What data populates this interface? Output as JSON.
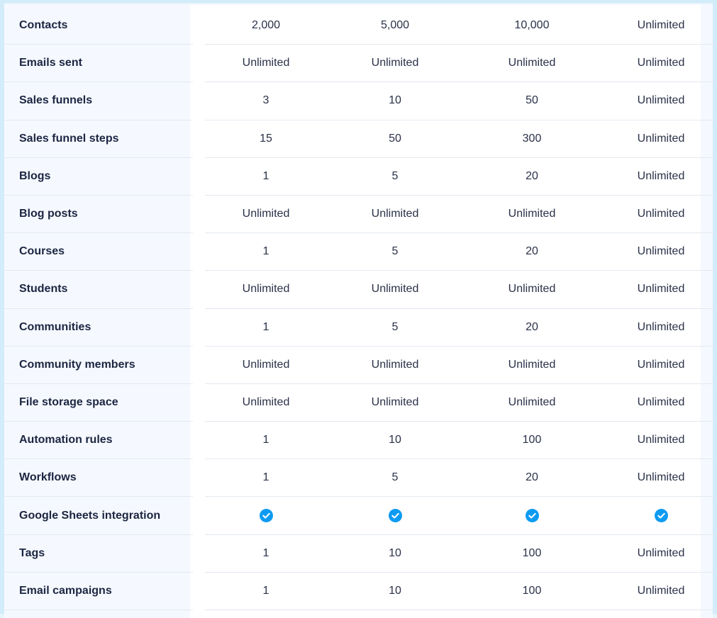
{
  "colors": {
    "accent": "#0d9bf2",
    "text": "#1c2541",
    "row_divider": "#e3e9f1",
    "label_column_bg": "#f5f9ff"
  },
  "rows": [
    {
      "feature": "Contacts",
      "values": [
        "2,000",
        "5,000",
        "10,000",
        "Unlimited"
      ]
    },
    {
      "feature": "Emails sent",
      "values": [
        "Unlimited",
        "Unlimited",
        "Unlimited",
        "Unlimited"
      ]
    },
    {
      "feature": "Sales funnels",
      "values": [
        "3",
        "10",
        "50",
        "Unlimited"
      ]
    },
    {
      "feature": "Sales funnel steps",
      "values": [
        "15",
        "50",
        "300",
        "Unlimited"
      ]
    },
    {
      "feature": "Blogs",
      "values": [
        "1",
        "5",
        "20",
        "Unlimited"
      ]
    },
    {
      "feature": "Blog posts",
      "values": [
        "Unlimited",
        "Unlimited",
        "Unlimited",
        "Unlimited"
      ]
    },
    {
      "feature": "Courses",
      "values": [
        "1",
        "5",
        "20",
        "Unlimited"
      ]
    },
    {
      "feature": "Students",
      "values": [
        "Unlimited",
        "Unlimited",
        "Unlimited",
        "Unlimited"
      ]
    },
    {
      "feature": "Communities",
      "values": [
        "1",
        "5",
        "20",
        "Unlimited"
      ]
    },
    {
      "feature": "Community members",
      "values": [
        "Unlimited",
        "Unlimited",
        "Unlimited",
        "Unlimited"
      ]
    },
    {
      "feature": "File storage space",
      "values": [
        "Unlimited",
        "Unlimited",
        "Unlimited",
        "Unlimited"
      ]
    },
    {
      "feature": "Automation rules",
      "values": [
        "1",
        "10",
        "100",
        "Unlimited"
      ]
    },
    {
      "feature": "Workflows",
      "values": [
        "1",
        "5",
        "20",
        "Unlimited"
      ]
    },
    {
      "feature": "Google Sheets integration",
      "values": [],
      "included": [
        true,
        true,
        true,
        true
      ],
      "icon": "check-circle-icon"
    },
    {
      "feature": "Tags",
      "values": [
        "1",
        "10",
        "100",
        "Unlimited"
      ]
    },
    {
      "feature": "Email campaigns",
      "values": [
        "1",
        "10",
        "100",
        "Unlimited"
      ]
    }
  ]
}
